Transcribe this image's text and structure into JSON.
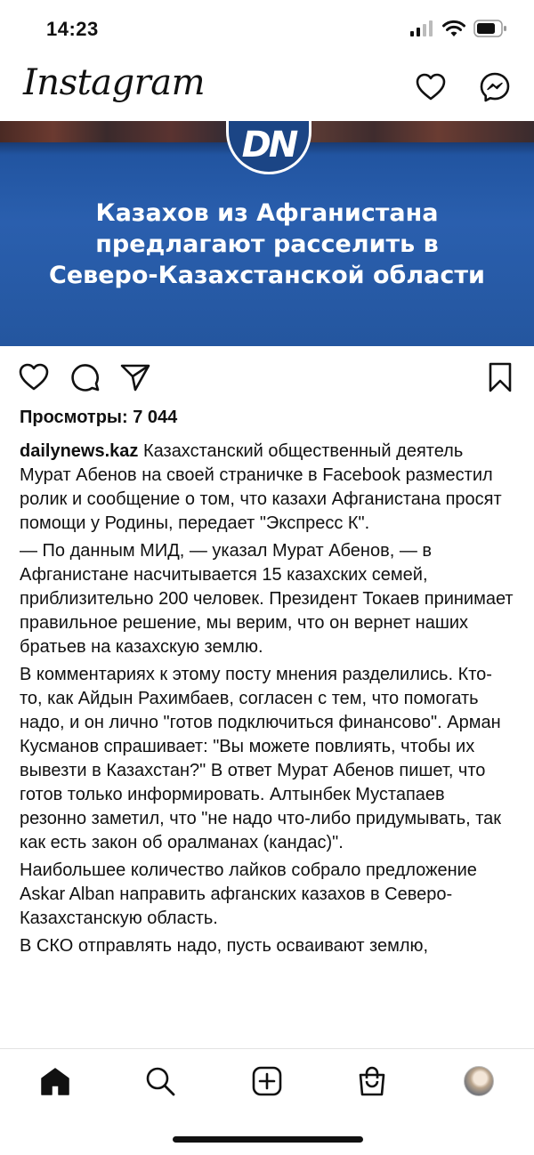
{
  "status_bar": {
    "time": "14:23"
  },
  "header": {
    "logo": "Instagram"
  },
  "post": {
    "image": {
      "logo_text": "DN",
      "headline_lines": [
        "Казахов из Афганистана",
        "предлагают расселить в",
        "Северо-Казахстанской области"
      ]
    },
    "views": "Просмотры: 7 044",
    "username": "dailynews.kaz",
    "paragraphs": [
      "Казахстанский общественный деятель Мурат Абенов на своей страничке в Facebook разместил ролик и сообщение о том, что казахи Афганистана просят помощи у Родины, передает \"Экспресс К\".",
      "— По данным МИД, — указал Мурат Абенов, — в Афганистане насчитывается 15 казахских семей, приблизительно 200 человек. Президент Токаев принимает правильное решение, мы верим, что он вернет наших братьев на казахскую землю.",
      "В комментариях к этому посту мнения разделились. Кто-то, как Айдын Рахимбаев, согласен с тем, что помогать надо, и он лично \"готов подключиться финансово\". Арман Кусманов спрашивает: \"Вы можете повлиять, чтобы их вывезти в Казахстан?\" В ответ Мурат Абенов пишет, что готов только информировать. Алтынбек Мустапаев резонно заметил, что \"не надо что-либо придумывать, так как есть закон об оралманах (кандас)\".",
      "Наибольшее количество лайков собрало предложение Askar Alban направить афганских казахов в Северо-Казахстанскую область.",
      "В СКО отправлять надо, пусть осваивают землю,"
    ]
  },
  "icons": {
    "header": [
      "heart-icon",
      "messenger-icon"
    ],
    "actions": [
      "like-icon",
      "comment-icon",
      "share-icon",
      "bookmark-icon"
    ],
    "tabs": [
      "home-icon",
      "search-icon",
      "new-post-icon",
      "shop-icon",
      "profile-avatar"
    ]
  },
  "colors": {
    "image_blue": "#24569f",
    "text": "#111111"
  }
}
